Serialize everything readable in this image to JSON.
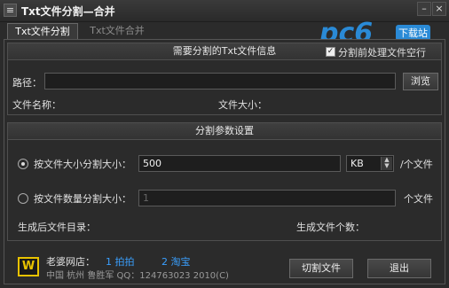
{
  "window": {
    "title": "Txt文件分割—合并",
    "icon": "menu-icon"
  },
  "tabs": [
    {
      "label": "Txt文件分割"
    },
    {
      "label": "Txt文件合并"
    }
  ],
  "file_info": {
    "header": "需要分割的Txt文件信息",
    "preprocess_label": "分割前处理文件空行",
    "path_label": "路径：",
    "path_value": "",
    "browse_label": "浏览",
    "filename_label": "文件名称：",
    "filesize_label": "文件大小："
  },
  "split_params": {
    "header": "分割参数设置",
    "by_size_label": "按文件大小分割大小：",
    "size_value": "500",
    "unit_value": "KB",
    "per_file_label": "/个文件",
    "by_count_label": "按文件数量分割大小：",
    "count_value": "1",
    "count_unit_label": "个文件",
    "output_dir_label": "生成后文件目录：",
    "output_count_label": "生成文件个数："
  },
  "footer": {
    "site_label": "老婆网店：",
    "link1": "1 拍拍",
    "link2": "2 淘宝",
    "credit": "中国 杭州 鲁胜军  QQ：124763023  2010(C)",
    "split_button": "切割文件",
    "exit_button": "退出"
  },
  "watermark": {
    "text": "pc6",
    "sub": "下载站"
  }
}
